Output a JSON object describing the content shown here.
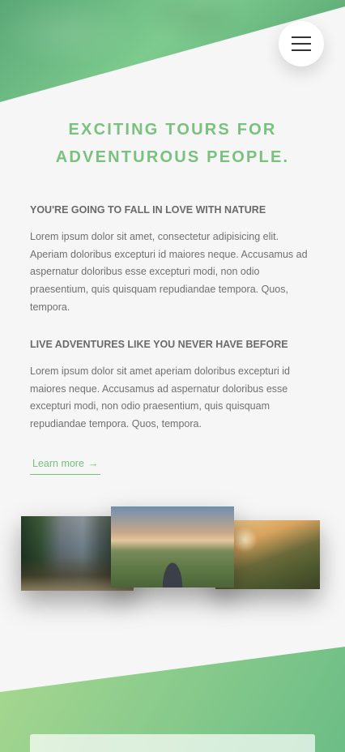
{
  "header": {
    "menu_icon": "hamburger-menu-icon",
    "accent_color": "#7ac07f"
  },
  "hero": {
    "headline_line1": "EXCITING TOURS FOR",
    "headline_line2": "ADVENTUROUS PEOPLE."
  },
  "sections": [
    {
      "title": "YOU'RE GOING TO FALL IN LOVE WITH NATURE",
      "text": "Lorem ipsum dolor sit amet, consectetur adipisicing elit. Aperiam doloribus excepturi id maiores neque. Accusamus ad aspernatur doloribus esse excepturi modi, non odio praesentium, quis quisquam repudiandae tempora. Quos, tempora."
    },
    {
      "title": "LIVE ADVENTURES LIKE YOU NEVER HAVE BEFORE",
      "text": "Lorem ipsum dolor sit amet aperiam doloribus excepturi id maiores neque. Accusamus ad aspernatur doloribus esse excepturi modi, non odio praesentium, quis quisquam repudiandae tempora. Quos, tempora."
    }
  ],
  "cta": {
    "label": "Learn more",
    "arrow": "→"
  },
  "photos": [
    {
      "name": "forest-valley-photo"
    },
    {
      "name": "mountain-road-cyclist-photo"
    },
    {
      "name": "mountain-ridge-sunset-photo"
    }
  ]
}
